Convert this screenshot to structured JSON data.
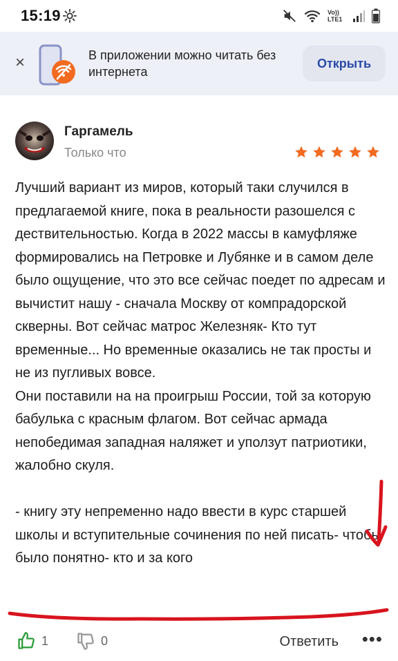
{
  "status_bar": {
    "time": "15:19",
    "volte_label": "Vo)) LTE1",
    "icons": [
      "gear-icon",
      "mute-icon",
      "wifi-icon",
      "volte-icon",
      "signal-icon",
      "battery-icon"
    ]
  },
  "banner": {
    "close_symbol": "×",
    "text": "В приложении можно читать без интернета",
    "button_label": "Открыть",
    "accent_color": "#2a4aa8",
    "icon_color": "#f26b21"
  },
  "review": {
    "author": "Гаргамель",
    "time": "Только что",
    "rating": 5,
    "rating_max": 5,
    "star_color": "#f26b21",
    "paragraphs": [
      "Лучший вариант из миров, который таки случился в предлагаемой книге, пока в реальности разошелся с дествительностью. Когда в 2022 массы в камуфляже формировались на Петровке и Лубянке и в самом деле было ощущение, что это все сейчас поедет по адресам и вычистит нашу - сначала Москву от компрадорской скверны. Вот сейчас матрос Железняк- Кто тут временные... Но временные оказались не так просты и не из пугливых вовсе.",
      "Они поставили на на проигрыш России, той за которую бабулька с красным флагом. Вот сейчас армада непобедимая западная наляжет и уползут патриотики, жалобно скуля.",
      "- книгу эту непременно надо ввести в курс старшей школы и вступительные сочинения по ней писать- чтобы было понятно- кто и за кого"
    ]
  },
  "actions": {
    "likes": "1",
    "dislikes": "0",
    "reply_label": "Ответить",
    "more_symbol": "•••",
    "like_color": "#2e9e3a"
  },
  "annotation_color": "#d8141e"
}
